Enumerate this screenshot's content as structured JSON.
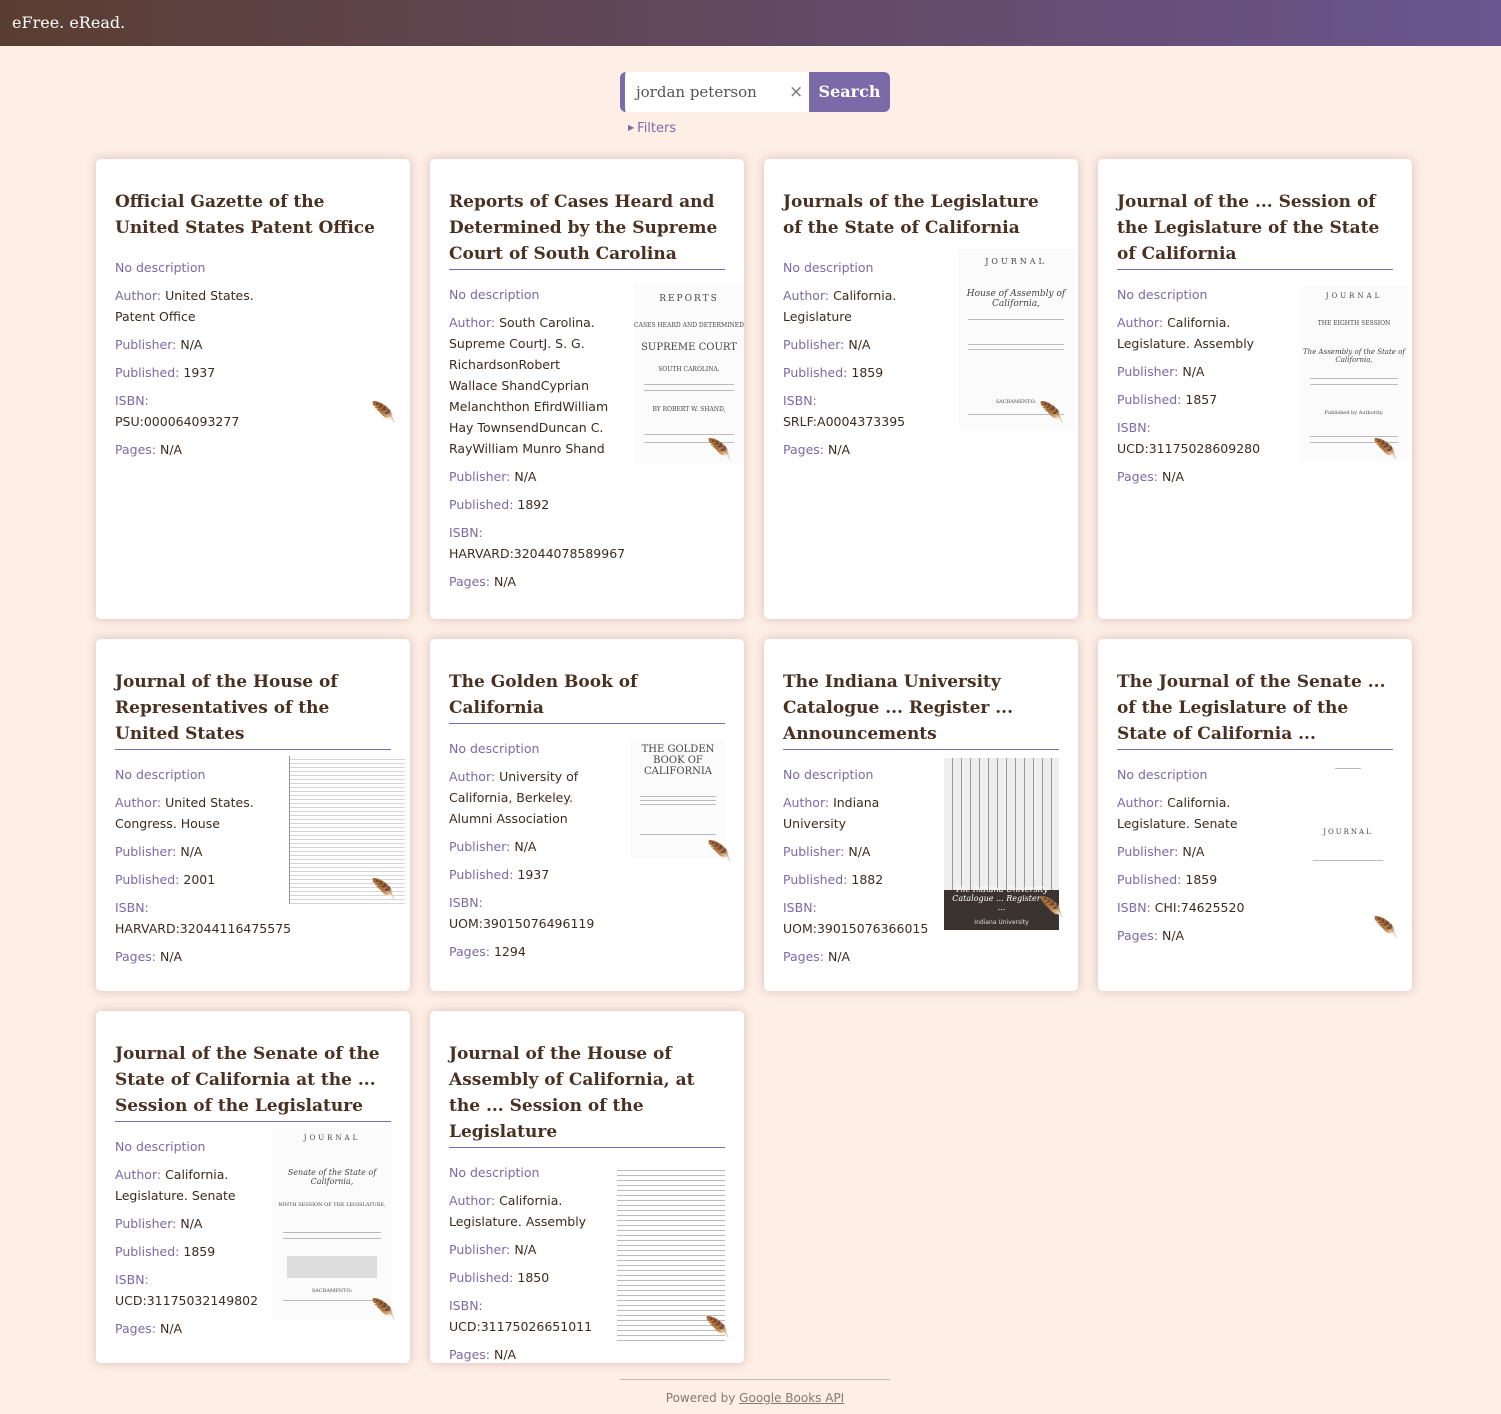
{
  "app": {
    "brand": "eFree. eRead."
  },
  "search": {
    "value": "jordan peterson",
    "clear_glyph": "×",
    "button_label": "Search"
  },
  "filters": {
    "label": "Filters"
  },
  "labels": {
    "no_description": "No description",
    "author": "Author:",
    "publisher": "Publisher:",
    "published": "Published:",
    "isbn": "ISBN:",
    "pages": "Pages:"
  },
  "books": [
    {
      "title": "Official Gazette of the United States Patent Office",
      "author": "United States. Patent Office",
      "publisher": "N/A",
      "published": "1937",
      "isbn": "PSU:000064093277",
      "pages": "N/A",
      "has_thumb": false,
      "thumb_icon": "link-feather-icon"
    },
    {
      "title": "Reports of Cases Heard and Determined by the Supreme Court of South Carolina",
      "author": "South Carolina. Supreme CourtJ. S. G. RichardsonRobert Wallace ShandCyprian Melanchthon EfirdWilliam Hay TownsendDuncan C. RayWilliam Munro Shand",
      "publisher": "N/A",
      "published": "1892",
      "isbn": "HARVARD:32044078589967",
      "pages": "N/A",
      "has_thumb": true,
      "thumb_text": "SUPREME COURT"
    },
    {
      "title": "Journals of the Legislature of the State of California",
      "author": "California. Legislature",
      "publisher": "N/A",
      "published": "1859",
      "isbn": "SRLF:A0004373395",
      "pages": "N/A",
      "has_thumb": true,
      "thumb_text": "JOURNAL"
    },
    {
      "title": "Journal of the ... Session of the Legislature of the State of California",
      "author": "California. Legislature. Assembly",
      "publisher": "N/A",
      "published": "1857",
      "isbn": "UCD:31175028609280",
      "pages": "N/A",
      "has_thumb": true,
      "thumb_text": "JOURNAL"
    },
    {
      "title": "Journal of the House of Representatives of the United States",
      "author": "United States. Congress. House",
      "publisher": "N/A",
      "published": "2001",
      "isbn": "HARVARD:32044116475575",
      "pages": "N/A",
      "has_thumb": true,
      "thumb_text": ""
    },
    {
      "title": "The Golden Book of California",
      "author": "University of California, Berkeley. Alumni Association",
      "publisher": "N/A",
      "published": "1937",
      "isbn": "UOM:39015076496119",
      "pages": "1294",
      "has_thumb": true,
      "thumb_text": "THE GOLDEN BOOK OF CALIFORNIA"
    },
    {
      "title": "The Indiana University Catalogue ... Register ... Announcements",
      "author": "Indiana University",
      "publisher": "N/A",
      "published": "1882",
      "isbn": "UOM:39015076366015",
      "pages": "N/A",
      "has_thumb": true,
      "thumb_text": "The Indiana University Catalogue ... Register ... ...",
      "thumb_sub": "Indiana University"
    },
    {
      "title": "The Journal of the Senate ... of the Legislature of the State of California ...",
      "author": "California. Legislature. Senate",
      "publisher": "N/A",
      "published": "1859",
      "isbn": "CHI:74625520",
      "pages": "N/A",
      "has_thumb": true,
      "thumb_text": "JOURNAL"
    },
    {
      "title": "Journal of the Senate of the State of California at the ... Session of the Legislature",
      "author": "California. Legislature. Senate",
      "publisher": "N/A",
      "published": "1859",
      "isbn": "UCD:31175032149802",
      "pages": "N/A",
      "has_thumb": true,
      "thumb_text": "JOURNAL"
    },
    {
      "title": "Journal of the House of Assembly of California, at the ... Session of the Legislature",
      "author": "California. Legislature. Assembly",
      "publisher": "N/A",
      "published": "1850",
      "isbn": "UCD:31175026651011",
      "pages": "N/A",
      "has_thumb": true,
      "thumb_text": ""
    }
  ],
  "footer": {
    "prefix": "Powered by",
    "link": "Google Books API"
  },
  "colors": {
    "accent": "#7a6aa8",
    "background": "#fdeee6",
    "header_start": "#5a3d31",
    "header_end": "#6a5590"
  }
}
